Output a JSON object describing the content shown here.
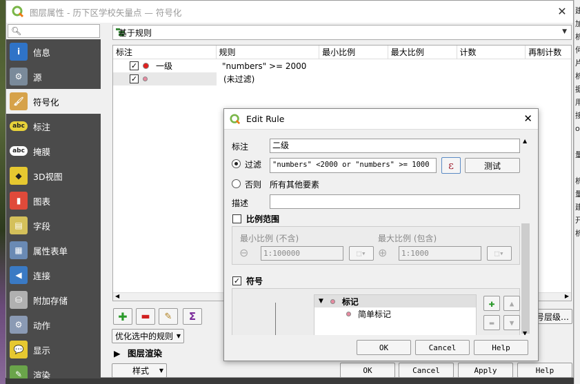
{
  "window": {
    "title": "图层属性 - 历下区学校矢量点 — 符号化",
    "close_label": "✕"
  },
  "nav": {
    "search_placeholder": "",
    "items": [
      {
        "label": "信息",
        "icon": "info-icon",
        "color": "#2f73c7",
        "glyph": "i"
      },
      {
        "label": "源",
        "icon": "source-icon",
        "color": "#7a8a9a",
        "glyph": "⚙"
      },
      {
        "label": "符号化",
        "icon": "symbology-icon",
        "color": "#d6a24a",
        "glyph": "🖌"
      },
      {
        "label": "标注",
        "icon": "labels-icon",
        "color": "#e8d23a",
        "glyph": "abc"
      },
      {
        "label": "掩膜",
        "icon": "mask-icon",
        "color": "#ffffff",
        "glyph": "abc"
      },
      {
        "label": "3D视图",
        "icon": "3d-view-icon",
        "color": "#e6c830",
        "glyph": "◆"
      },
      {
        "label": "图表",
        "icon": "diagrams-icon",
        "color": "#e04a3a",
        "glyph": "▮"
      },
      {
        "label": "字段",
        "icon": "fields-icon",
        "color": "#d4c05a",
        "glyph": "▤"
      },
      {
        "label": "属性表单",
        "icon": "attributes-form-icon",
        "color": "#6a8ab4",
        "glyph": "▦"
      },
      {
        "label": "连接",
        "icon": "joins-icon",
        "color": "#3a7ac4",
        "glyph": "◀"
      },
      {
        "label": "附加存储",
        "icon": "auxiliary-storage-icon",
        "color": "#b0b0b0",
        "glyph": "⛁"
      },
      {
        "label": "动作",
        "icon": "actions-icon",
        "color": "#8a9ab4",
        "glyph": "⚙"
      },
      {
        "label": "显示",
        "icon": "display-icon",
        "color": "#e6c830",
        "glyph": "💬"
      },
      {
        "label": "渲染",
        "icon": "rendering-icon",
        "color": "#6aa44a",
        "glyph": "✎"
      }
    ],
    "active_index": 2
  },
  "renderer": {
    "selected": "基于规则"
  },
  "table": {
    "columns": [
      "标注",
      "规则",
      "最小比例",
      "最大比例",
      "计数",
      "再制计数"
    ],
    "rows": [
      {
        "checked": true,
        "color": "#e0201f",
        "label": "一级",
        "rule": "\"numbers\" >= 2000"
      },
      {
        "checked": true,
        "color": "#e88aa0",
        "label": "",
        "rule": "(未过滤)"
      }
    ]
  },
  "bottom": {
    "refine_label": "优化选中的规则",
    "layer_render_label": "图层渲染",
    "style_label": "样式",
    "ok": "OK",
    "cancel": "Cancel",
    "apply": "Apply",
    "help": "Help",
    "symbol_levels_fragment": "号层级…"
  },
  "dialog": {
    "title": "Edit Rule",
    "label_caption": "标注",
    "label_value": "二级",
    "filter_caption": "过滤",
    "filter_value": " \"numbers\" <2000 or  \"numbers\" >= 1000",
    "test_label": "测试",
    "else_caption": "否则",
    "else_desc": "所有其他要素",
    "desc_caption": "描述",
    "desc_value": "",
    "scale_caption": "比例范围",
    "min_scale_caption": "最小比例 (不含)",
    "max_scale_caption": "最大比例 (包含)",
    "min_scale_value": "1:100000",
    "max_scale_value": "1:1000",
    "symbol_caption": "符号",
    "symbol_tree": [
      "标记",
      "简单标记"
    ],
    "ok": "OK",
    "cancel": "Cancel",
    "help": "Help"
  },
  "right_strip_chars": [
    "建",
    "加",
    "析",
    "何",
    "片",
    "析",
    "据",
    "用",
    "接",
    "ov",
    "",
    "量",
    "",
    "析",
    "量",
    "建",
    "开",
    "析"
  ]
}
